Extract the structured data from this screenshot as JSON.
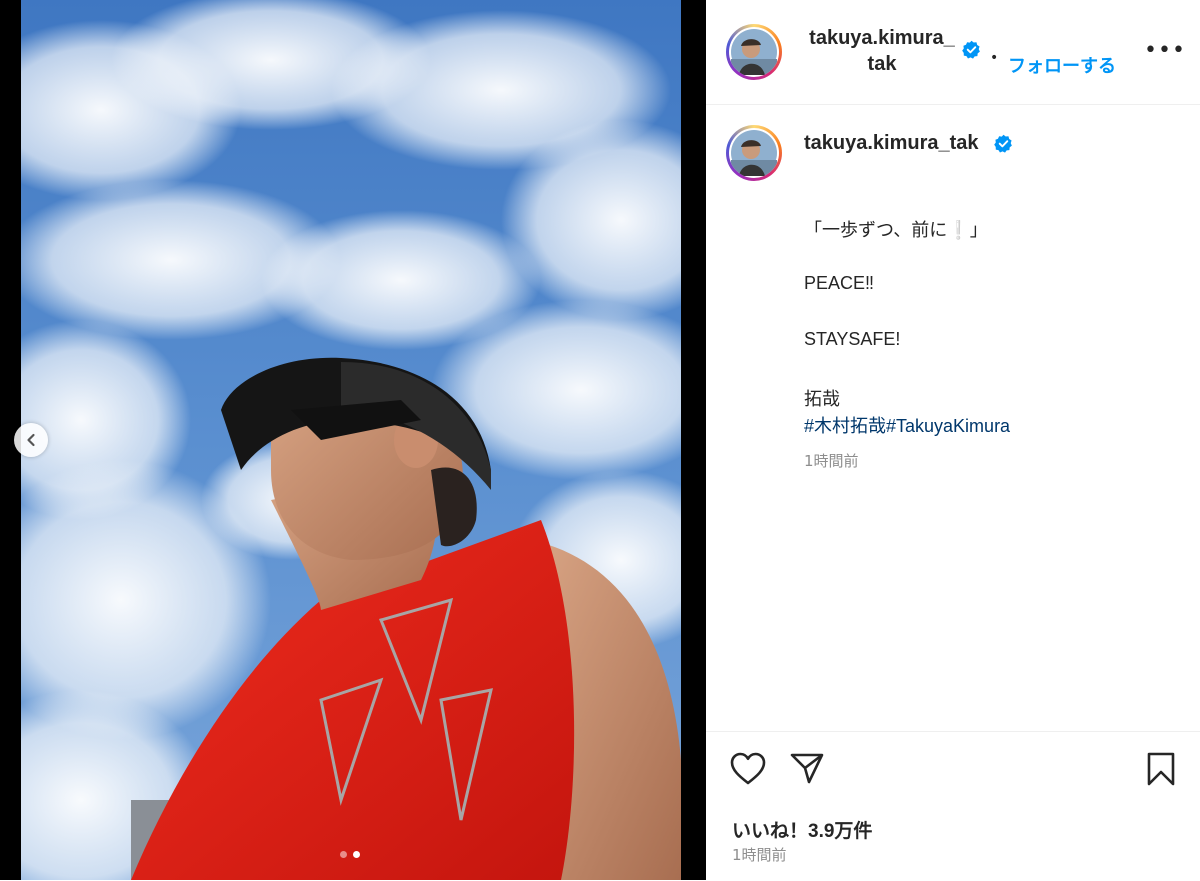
{
  "post": {
    "photo_alt": "man in cap and sunglasses under a cloudy blue sky",
    "carousel": {
      "total": 2,
      "active_index": 1
    }
  },
  "header": {
    "username_line1": "takuya.kimura_",
    "username_line2": "tak",
    "separator": "•",
    "follow_label": "フォローする",
    "more_label": "•••"
  },
  "caption": {
    "username": "takuya.kimura_tak",
    "lines": [
      "「一歩ずつ、前に❕」",
      "PEACE‼",
      "STAYSAFE!",
      "拓哉"
    ],
    "hashtags": "#木村拓哉#TakuyaKimura",
    "time": "1時間前"
  },
  "actions": {
    "likes": "いいね！3.9万件",
    "time": "1時間前"
  },
  "colors": {
    "accent": "#0095f6",
    "hashtag": "#00376b",
    "muted": "#8e8e8e",
    "verified": "#0095f6"
  },
  "icons": [
    "chevron-left-icon",
    "verified-icon",
    "more-icon",
    "heart-icon",
    "share-icon",
    "bookmark-icon"
  ]
}
